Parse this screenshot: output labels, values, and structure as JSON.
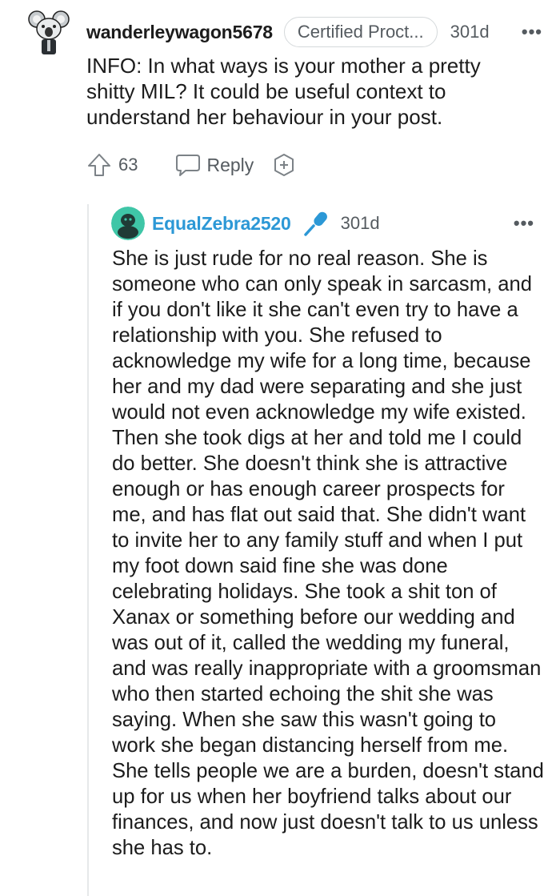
{
  "parent_comment": {
    "username": "wanderleywagon5678",
    "flair": "Certified Proct...",
    "age": "301d",
    "more_icon": "ellipsis-icon",
    "body": "INFO: In what ways is your mother a pretty shitty MIL? It could be useful context to understand her behaviour in your post.",
    "score": "63",
    "reply_label": "Reply"
  },
  "reply_comment": {
    "username": "EqualZebra2520",
    "badge_icon": "microphone-icon",
    "age": "301d",
    "more_icon": "ellipsis-icon",
    "body": "She is just rude for no real reason. She is someone who can only speak in sarcasm, and if you don't like it she can't even try to have a relationship with you. She refused to acknowledge my wife for a long time, because her and my dad were separating and she just would not even acknowledge my wife existed. Then she took digs at her and told me I could do better. She doesn't think she is attractive enough or has enough career prospects for me, and has flat out said that. She didn't want to invite her to any family stuff and when I put my foot down said fine she was done celebrating holidays. She took a shit ton of Xanax or something before our wedding and was out of it, called the wedding my funeral, and was really inappropriate with a groomsman who then started echoing the shit she was saying. When she saw this wasn't going to work she began distancing herself from me. She tells people we are a burden, doesn't stand up for us when her boyfriend talks about our finances, and now just doesn't talk to us unless she has to."
  },
  "colors": {
    "username_reply": "#2c98d6",
    "meta_text": "#555b60",
    "mic_badge": "#2c98d6",
    "reply_avatar": "#3fc6a7"
  }
}
